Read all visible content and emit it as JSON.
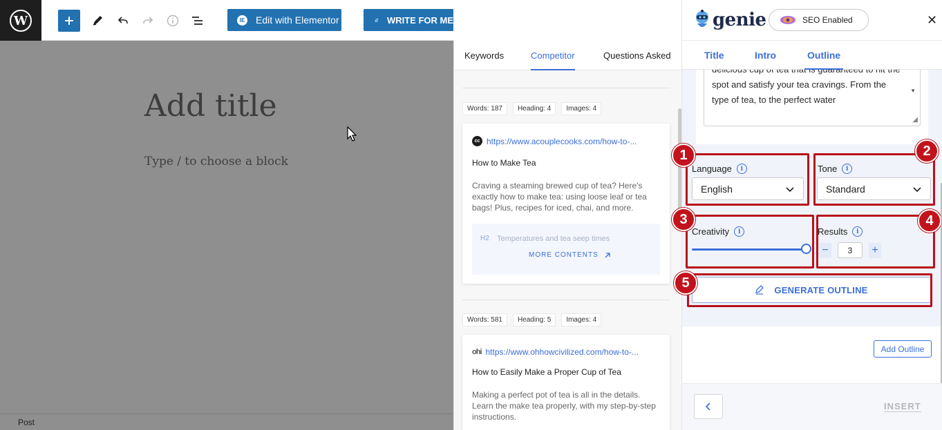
{
  "toolbar": {
    "wp_logo": "W",
    "elementor_badge": "IE",
    "edit_elementor_label": "Edit with Elementor",
    "write_label": "WRITE FOR ME"
  },
  "editor": {
    "title_placeholder": "Add title",
    "block_placeholder": "Type / to choose a block",
    "status_label": "Post"
  },
  "competitor": {
    "tabs": [
      {
        "label": "Keywords"
      },
      {
        "label": "Competitor"
      },
      {
        "label": "Questions Asked"
      }
    ],
    "cards": [
      {
        "stats": [
          "Words: 187",
          "Heading: 4",
          "Images: 4"
        ],
        "site_icon": "cc",
        "url": "https://www.acouplecooks.com/how-to-...",
        "title": "How to Make Tea",
        "description": "Craving a steaming brewed cup of tea? Here's exactly how to make tea: using loose leaf or tea bags! Plus, recipes for iced, chai, and more.",
        "heading_tag": "H2",
        "heading_text": "Temperatures and tea seep times",
        "more_label": "MORE CONTENTS"
      },
      {
        "stats": [
          "Words: 581",
          "Heading: 5",
          "Images: 4"
        ],
        "site_icon": "ohi",
        "url": "https://www.ohhowcivilized.com/how-to-...",
        "title": "How to Easily Make a Proper Cup of Tea",
        "description": "Making a perfect pot of tea is all in the details. Learn the make tea properly, with my step-by-step instructions."
      }
    ]
  },
  "genie": {
    "logo_text": "genie",
    "seo_label": "SEO Enabled",
    "close_label": "✕",
    "tabs": [
      {
        "label": "Title"
      },
      {
        "label": "Intro"
      },
      {
        "label": "Outline"
      }
    ],
    "textarea_text": "delicious cup of tea that is guaranteed to hit the spot and satisfy your tea cravings. From the type of tea, to the perfect water",
    "language": {
      "label": "Language",
      "value": "English"
    },
    "tone": {
      "label": "Tone",
      "value": "Standard"
    },
    "creativity": {
      "label": "Creativity",
      "value_fraction": 1.0
    },
    "results": {
      "label": "Results",
      "value": "3",
      "minus": "−",
      "plus": "+"
    },
    "generate_label": "GENERATE OUTLINE",
    "add_outline_label": "Add Outline",
    "insert_label": "INSERT",
    "annotations": [
      "1",
      "2",
      "3",
      "4",
      "5"
    ]
  },
  "colors": {
    "accent": "#3b6fd8",
    "wp_blue": "#2271b1",
    "annotation_red": "#c2121c"
  }
}
